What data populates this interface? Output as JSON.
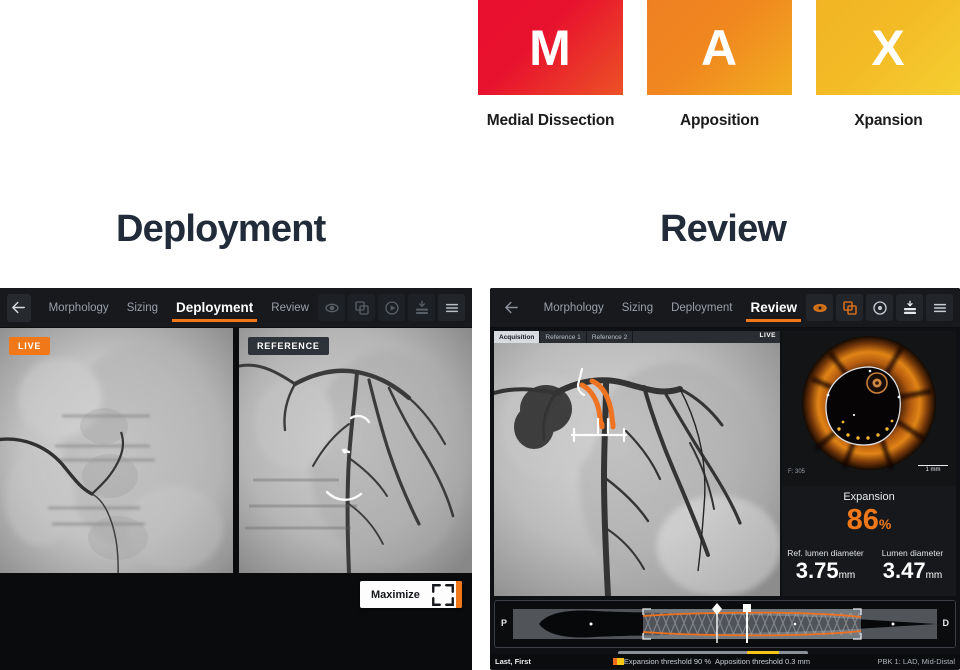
{
  "max_legend": [
    {
      "letter": "M",
      "label": "Medial Dissection",
      "color": "#e8102e"
    },
    {
      "letter": "A",
      "label": "Apposition",
      "color": "#ef8022"
    },
    {
      "letter": "X",
      "label": "Xpansion",
      "color": "#f2b424"
    }
  ],
  "sections": {
    "left_title": "Deployment",
    "right_title": "Review"
  },
  "accent_color": "#f07818",
  "left_app": {
    "back_icon": "arrow-left-icon",
    "tabs": [
      {
        "label": "Morphology",
        "active": false
      },
      {
        "label": "Sizing",
        "active": false
      },
      {
        "label": "Deployment",
        "active": true
      },
      {
        "label": "Review",
        "active": false
      }
    ],
    "tool_icons": [
      "eye-icon",
      "layers-icon",
      "play-circle-icon",
      "save-icon",
      "menu-icon"
    ],
    "panes": [
      {
        "badge": "LIVE",
        "badge_style": "live"
      },
      {
        "badge": "REFERENCE",
        "badge_style": "ref"
      }
    ],
    "maximize_label": "Maximize",
    "maximize_icon": "expand-icon"
  },
  "right_app": {
    "back_icon": "arrow-left-icon",
    "tabs": [
      {
        "label": "Morphology",
        "active": false
      },
      {
        "label": "Sizing",
        "active": false
      },
      {
        "label": "Deployment",
        "active": false
      },
      {
        "label": "Review",
        "active": true
      }
    ],
    "tool_icons": [
      "eye-icon",
      "layers-icon",
      "play-circle-icon",
      "save-icon",
      "menu-icon"
    ],
    "image_tabs": [
      {
        "label": "Acquisition",
        "active": true
      },
      {
        "label": "Reference 1",
        "active": false
      },
      {
        "label": "Reference 2",
        "active": false
      }
    ],
    "live_tag": "LIVE",
    "oct": {
      "frame_label": "F: 305",
      "scale_label": "1 mm"
    },
    "metrics": {
      "expansion_label": "Expansion",
      "expansion_value": "86",
      "expansion_unit": "%",
      "ref_lumen_label": "Ref. lumen diameter",
      "ref_lumen_value": "3.75",
      "ref_lumen_unit": "mm",
      "lumen_label": "Lumen diameter",
      "lumen_value": "3.47",
      "lumen_unit": "mm"
    },
    "longitudinal": {
      "proximal_marker": "P",
      "distal_marker": "D"
    },
    "status": {
      "patient": "Last, First",
      "expansion_threshold": "Expansion threshold 90 %",
      "apposition_threshold": "Apposition threshold  0.3 mm",
      "vessel": "PBK 1: LAD, Mid-Distal"
    }
  }
}
